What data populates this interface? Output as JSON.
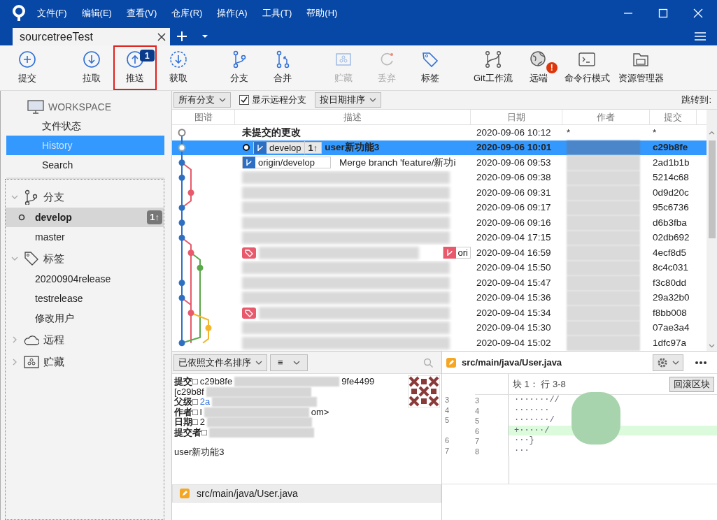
{
  "menu": [
    "文件(F)",
    "编辑(E)",
    "查看(V)",
    "仓库(R)",
    "操作(A)",
    "工具(T)",
    "帮助(H)"
  ],
  "tabs": [
    {
      "label": "sourcetreeTest",
      "selected": true
    }
  ],
  "toolbar": {
    "groups": [
      [
        {
          "kind": "commit",
          "label": "提交",
          "disabled": false,
          "highlighted": false
        }
      ],
      [
        {
          "kind": "pull",
          "label": "拉取",
          "disabled": false,
          "highlighted": false
        },
        {
          "kind": "push",
          "label": "推送",
          "disabled": false,
          "highlighted": true,
          "badge": {
            "kind": "count",
            "text": "1"
          }
        },
        {
          "kind": "fetch",
          "label": "获取",
          "disabled": false,
          "highlighted": false
        }
      ],
      [
        {
          "kind": "branch",
          "label": "分支",
          "disabled": false,
          "highlighted": false
        },
        {
          "kind": "merge",
          "label": "合并",
          "disabled": false,
          "highlighted": false
        }
      ],
      [
        {
          "kind": "stash",
          "label": "贮藏",
          "disabled": true,
          "highlighted": false
        },
        {
          "kind": "discard",
          "label": "丢弃",
          "disabled": true,
          "highlighted": false
        },
        {
          "kind": "tag",
          "label": "标签",
          "disabled": false,
          "highlighted": false
        }
      ],
      [
        {
          "kind": "gitflow",
          "label": "Git工作流",
          "disabled": false,
          "highlighted": false
        },
        {
          "kind": "remote",
          "label": "远端",
          "disabled": false,
          "highlighted": false,
          "badge": {
            "kind": "alert",
            "text": "!"
          }
        },
        {
          "kind": "terminal",
          "label": "命令行模式",
          "disabled": false,
          "highlighted": false
        },
        {
          "kind": "explorer",
          "label": "资源管理器",
          "disabled": false,
          "highlighted": false
        }
      ]
    ]
  },
  "sidebar": {
    "workspace": {
      "title": "WORKSPACE",
      "items": [
        {
          "label": "文件状态",
          "selected": false
        },
        {
          "label": "History",
          "selected": true
        },
        {
          "label": "Search",
          "selected": false
        }
      ]
    },
    "sections": [
      {
        "kind": "branches",
        "title": "分支",
        "expanded": true,
        "items": [
          {
            "label": "develop",
            "selected": true,
            "current": true,
            "badge": "1↑"
          },
          {
            "label": "master",
            "selected": false,
            "current": false
          }
        ]
      },
      {
        "kind": "tags",
        "title": "标签",
        "expanded": true,
        "items": [
          {
            "label": "20200904release",
            "selected": false
          },
          {
            "label": "testrelease",
            "selected": false
          },
          {
            "label": "修改用户",
            "selected": false
          }
        ]
      },
      {
        "kind": "remotes",
        "title": "远程",
        "expanded": false
      },
      {
        "kind": "stashes",
        "title": "贮藏",
        "expanded": false
      }
    ]
  },
  "filter_bar": {
    "branch_filter": "所有分支",
    "show_remote": {
      "label": "显示远程分支",
      "checked": true
    },
    "sort": "按日期排序",
    "jump_label": "跳转到:"
  },
  "history": {
    "columns": [
      "图谱",
      "描述",
      "日期",
      "作者",
      "提交"
    ],
    "rows": [
      {
        "title": "未提交的更改",
        "uncommitted": true,
        "selected": false,
        "date": "2020-09-06 10:12",
        "author": "*",
        "commit": "*",
        "refs": []
      },
      {
        "description": "user新功能3",
        "head": true,
        "selected": true,
        "date": "2020-09-06 10:01",
        "author_redacted": true,
        "commit": "c29b8fe",
        "refs": [
          {
            "kind": "branch",
            "label": "develop",
            "ahead": "1↑"
          }
        ]
      },
      {
        "description": "Merge branch 'feature/新功i",
        "selected": false,
        "date": "2020-09-06 09:53",
        "author_redacted": true,
        "commit": "2ad1b1b",
        "refs": [
          {
            "kind": "remote",
            "label": "origin/develop"
          }
        ]
      },
      {
        "description_redacted": true,
        "selected": false,
        "date": "2020-09-06 09:38",
        "author_redacted": true,
        "commit": "5214c68",
        "refs": []
      },
      {
        "description_redacted": true,
        "selected": false,
        "date": "2020-09-06 09:31",
        "author_redacted": true,
        "commit": "0d9d20c",
        "refs": []
      },
      {
        "description_redacted": true,
        "selected": false,
        "date": "2020-09-06 09:17",
        "author_redacted": true,
        "commit": "95c6736",
        "refs": []
      },
      {
        "description_redacted": true,
        "selected": false,
        "date": "2020-09-06 09:16",
        "author_redacted": true,
        "commit": "d6b3fba",
        "refs": []
      },
      {
        "description_redacted": true,
        "selected": false,
        "date": "2020-09-04 17:15",
        "author_redacted": true,
        "commit": "02db692",
        "refs": []
      },
      {
        "description_redacted": true,
        "selected": false,
        "date": "2020-09-04 16:59",
        "author_redacted": true,
        "commit": "4ecf8d5",
        "refs": [
          {
            "kind": "tag"
          }
        ],
        "trailing_ref": {
          "kind": "branch",
          "label": "ori"
        }
      },
      {
        "description_redacted": true,
        "selected": false,
        "date": "2020-09-04 15:50",
        "author_redacted": true,
        "commit": "8c4c031",
        "refs": []
      },
      {
        "description_redacted": true,
        "selected": false,
        "date": "2020-09-04 15:47",
        "author_redacted": true,
        "commit": "f3c80dd",
        "refs": []
      },
      {
        "description_redacted": true,
        "selected": false,
        "date": "2020-09-04 15:36",
        "author_redacted": true,
        "commit": "29a32b0",
        "refs": []
      },
      {
        "description_redacted": true,
        "selected": false,
        "date": "2020-09-04 15:34",
        "author_redacted": true,
        "commit": "f8bb008",
        "refs": [
          {
            "kind": "tag"
          }
        ]
      },
      {
        "description_redacted": true,
        "selected": false,
        "date": "2020-09-04 15:30",
        "author_redacted": true,
        "commit": "07ae3a4",
        "refs": []
      },
      {
        "description_redacted": true,
        "selected": false,
        "date": "2020-09-04 15:02",
        "author_redacted": true,
        "commit": "1dfc97a",
        "refs": []
      }
    ]
  },
  "files_panel": {
    "sort": "已依照文件名排序",
    "view_mode": "≡",
    "details": [
      {
        "label": "提交□",
        "values": [
          "c29b8fe",
          "9fe4499"
        ],
        "redacted": true
      },
      {
        "values": [
          "[c29b8f"
        ],
        "redacted": true
      },
      {
        "label": "父级□",
        "link": "2a",
        "redacted": true
      },
      {
        "label": "作者□",
        "values": [
          "l",
          "om>"
        ],
        "redacted": true
      },
      {
        "label": "日期□",
        "values": [
          "2"
        ],
        "redacted": true
      },
      {
        "label": "提交者□",
        "redacted": true
      }
    ],
    "message": "user新功能3",
    "files": [
      {
        "path": "src/main/java/User.java",
        "selected": true
      }
    ]
  },
  "diff": {
    "file": "src/main/java/User.java",
    "hunk_title": "块 1： 行 3-8",
    "revert_button": "回滚区块",
    "lines": [
      {
        "kind": "context",
        "old": "3",
        "new": "3",
        "text": "·······//"
      },
      {
        "kind": "context",
        "old": "4",
        "new": "4",
        "text": "·······"
      },
      {
        "kind": "context",
        "old": "5",
        "new": "5",
        "text": "·······/"
      },
      {
        "kind": "added",
        "new": "6",
        "text": "+·····/"
      },
      {
        "kind": "context",
        "old": "6",
        "new": "7",
        "text": "···}"
      },
      {
        "kind": "context",
        "old": "7",
        "new": "8",
        "text": "···"
      }
    ]
  }
}
